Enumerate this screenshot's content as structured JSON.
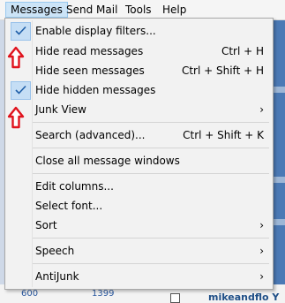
{
  "menubar": {
    "items": [
      {
        "label": "Messages",
        "active": true
      },
      {
        "label": "Send Mail",
        "active": false
      },
      {
        "label": "Tools",
        "active": false
      },
      {
        "label": "Help",
        "active": false
      }
    ]
  },
  "menu": {
    "items": [
      {
        "label": "Enable display filters...",
        "checked": true
      },
      {
        "label": "Hide read messages",
        "shortcut": "Ctrl + H"
      },
      {
        "label": "Hide seen messages",
        "shortcut": "Ctrl + Shift + H"
      },
      {
        "label": "Hide hidden messages",
        "checked": true
      },
      {
        "label": "Junk View",
        "submenu": true
      },
      {
        "label": "Search (advanced)...",
        "shortcut": "Ctrl + Shift + K"
      },
      {
        "label": "Close all message windows"
      },
      {
        "label": "Edit columns..."
      },
      {
        "label": "Select font..."
      },
      {
        "label": "Sort",
        "submenu": true
      },
      {
        "label": "Speech",
        "submenu": true
      },
      {
        "label": "AntiJunk",
        "submenu": true
      }
    ],
    "submenu_arrow": "›"
  },
  "background": {
    "numbers": [
      "600",
      "1399"
    ],
    "name": "mikeandflo Y"
  },
  "colors": {
    "menu_bg": "#f2f2f2",
    "highlight": "#cce4f7",
    "annotation_arrow": "#e0141e"
  }
}
